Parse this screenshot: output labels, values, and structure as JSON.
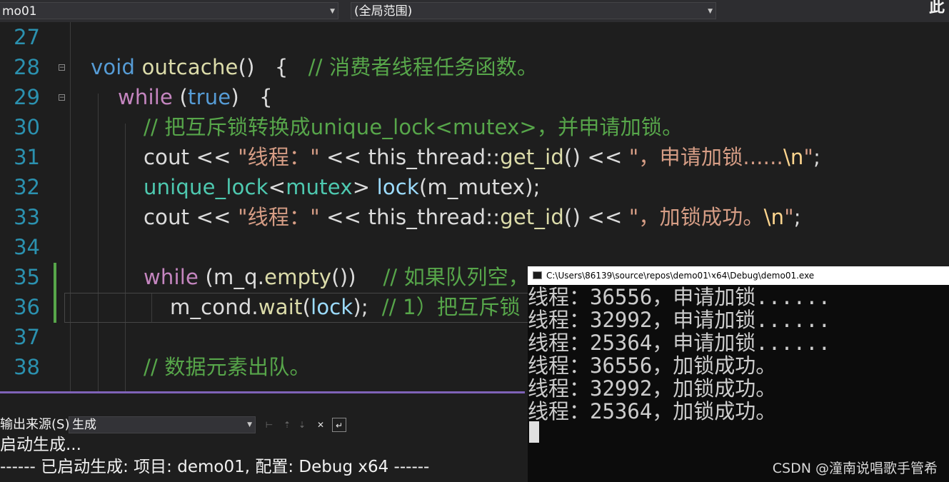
{
  "toolbar": {
    "project_dropdown": "mo01",
    "scope_dropdown": "(全局范围)",
    "corner_text": "此"
  },
  "editor": {
    "line_numbers": [
      "27",
      "28",
      "29",
      "30",
      "31",
      "32",
      "33",
      "34",
      "35",
      "36",
      "37",
      "38"
    ],
    "lines": [
      {
        "num": "27",
        "segments": []
      },
      {
        "num": "28",
        "segments": [
          {
            "cls": "kwb",
            "text": "void"
          },
          {
            "cls": "",
            "text": " "
          },
          {
            "cls": "fn",
            "text": "outcache"
          },
          {
            "cls": "",
            "text": "()   {   "
          },
          {
            "cls": "cm",
            "text": "// 消费者线程任务函数。"
          }
        ]
      },
      {
        "num": "29",
        "segments": [
          {
            "cls": "kw",
            "text": "while"
          },
          {
            "cls": "",
            "text": " ("
          },
          {
            "cls": "kwb",
            "text": "true"
          },
          {
            "cls": "",
            "text": ")   {"
          }
        ]
      },
      {
        "num": "30",
        "segments": [
          {
            "cls": "cm",
            "text": "// 把互斥锁转换成unique_lock<mutex>，并申请加锁。"
          }
        ]
      },
      {
        "num": "31",
        "segments": [
          {
            "cls": "",
            "text": "cout << "
          },
          {
            "cls": "st",
            "text": "\"线程：\""
          },
          {
            "cls": "",
            "text": " << this_thread::"
          },
          {
            "cls": "fn",
            "text": "get_id"
          },
          {
            "cls": "",
            "text": "() << "
          },
          {
            "cls": "st",
            "text": "\"，申请加锁......"
          },
          {
            "cls": "esc",
            "text": "\\n"
          },
          {
            "cls": "st",
            "text": "\""
          },
          {
            "cls": "",
            "text": ";"
          }
        ]
      },
      {
        "num": "32",
        "segments": [
          {
            "cls": "ty",
            "text": "unique_lock"
          },
          {
            "cls": "",
            "text": "<"
          },
          {
            "cls": "ty",
            "text": "mutex"
          },
          {
            "cls": "",
            "text": "> "
          },
          {
            "cls": "var",
            "text": "lock"
          },
          {
            "cls": "",
            "text": "(m_mutex);"
          }
        ]
      },
      {
        "num": "33",
        "segments": [
          {
            "cls": "",
            "text": "cout << "
          },
          {
            "cls": "st",
            "text": "\"线程：\""
          },
          {
            "cls": "",
            "text": " << this_thread::"
          },
          {
            "cls": "fn",
            "text": "get_id"
          },
          {
            "cls": "",
            "text": "() << "
          },
          {
            "cls": "st",
            "text": "\"，加锁成功。"
          },
          {
            "cls": "esc",
            "text": "\\n"
          },
          {
            "cls": "st",
            "text": "\""
          },
          {
            "cls": "",
            "text": ";"
          }
        ]
      },
      {
        "num": "34",
        "segments": []
      },
      {
        "num": "35",
        "segments": [
          {
            "cls": "kw",
            "text": "while"
          },
          {
            "cls": "",
            "text": " (m_q."
          },
          {
            "cls": "fn",
            "text": "empty"
          },
          {
            "cls": "",
            "text": "())    "
          },
          {
            "cls": "cm",
            "text": "// 如果队列空，"
          }
        ]
      },
      {
        "num": "36",
        "segments": [
          {
            "cls": "",
            "text": "m_cond."
          },
          {
            "cls": "fn",
            "text": "wait"
          },
          {
            "cls": "",
            "text": "("
          },
          {
            "cls": "var",
            "text": "lock"
          },
          {
            "cls": "",
            "text": ");  "
          },
          {
            "cls": "cm",
            "text": "// 1）把互斥锁"
          }
        ]
      },
      {
        "num": "37",
        "segments": []
      },
      {
        "num": "38",
        "segments": [
          {
            "cls": "cm",
            "text": "// 数据元素出队。"
          }
        ]
      }
    ]
  },
  "output_panel": {
    "source_label": "输出来源(S):",
    "source_value": "生成",
    "lines": [
      "启动生成...",
      "------ 已启动生成: 项目: demo01, 配置: Debug x64 ------"
    ]
  },
  "console": {
    "title": "C:\\Users\\86139\\source\\repos\\demo01\\x64\\Debug\\demo01.exe",
    "lines": [
      "线程：36556，申请加锁......",
      "线程：32992，申请加锁......",
      "线程：25364，申请加锁......",
      "线程：36556，加锁成功。",
      "线程：32992，加锁成功。",
      "线程：25364，加锁成功。"
    ]
  },
  "watermark": "CSDN @潼南说唱歌手管希"
}
